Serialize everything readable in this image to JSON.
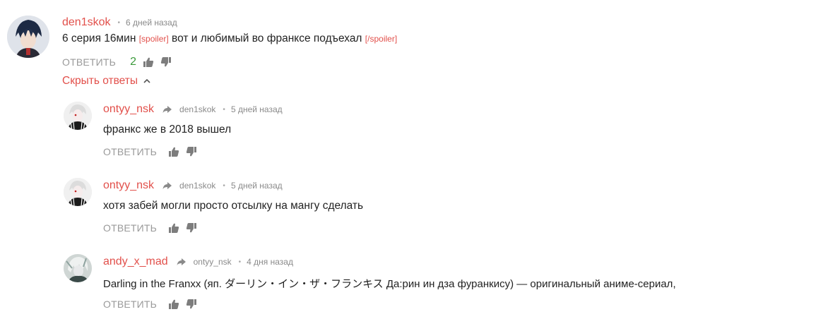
{
  "comments": [
    {
      "author": "den1skok",
      "time": "6 дней назад",
      "text_before": "6 серия 16мин",
      "spoiler_open": "[spoiler]",
      "spoiler_text": "вот и любимый во франксе подъехал",
      "spoiler_close": "[/spoiler]",
      "reply_label": "ОТВЕТИТЬ",
      "score": "2"
    }
  ],
  "hide_replies_label": "Скрыть ответы",
  "replies": [
    {
      "author": "ontyy_nsk",
      "reply_to": "den1skok",
      "time": "5 дней назад",
      "text": "франкс же в 2018 вышел",
      "reply_label": "ОТВЕТИТЬ"
    },
    {
      "author": "ontyy_nsk",
      "reply_to": "den1skok",
      "time": "5 дней назад",
      "text": "хотя забей могли просто отсылку на мангу сделать",
      "reply_label": "ОТВЕТИТЬ"
    },
    {
      "author": "andy_x_mad",
      "reply_to": "ontyy_nsk",
      "time": "4 дня назад",
      "text": "Darling in the Franxx (яп. ダーリン・イン・ザ・フランキス Да:рин ин дза фуранкису) — оригинальный аниме-сериал,",
      "reply_label": "ОТВЕТИТЬ"
    }
  ],
  "colors": {
    "accent": "#e2504b",
    "muted": "#9a9a9a",
    "score_positive": "#3b9a3b"
  },
  "icons": [
    "reply-arrow-icon",
    "thumbs-up-icon",
    "thumbs-down-icon",
    "chevron-up-icon"
  ]
}
